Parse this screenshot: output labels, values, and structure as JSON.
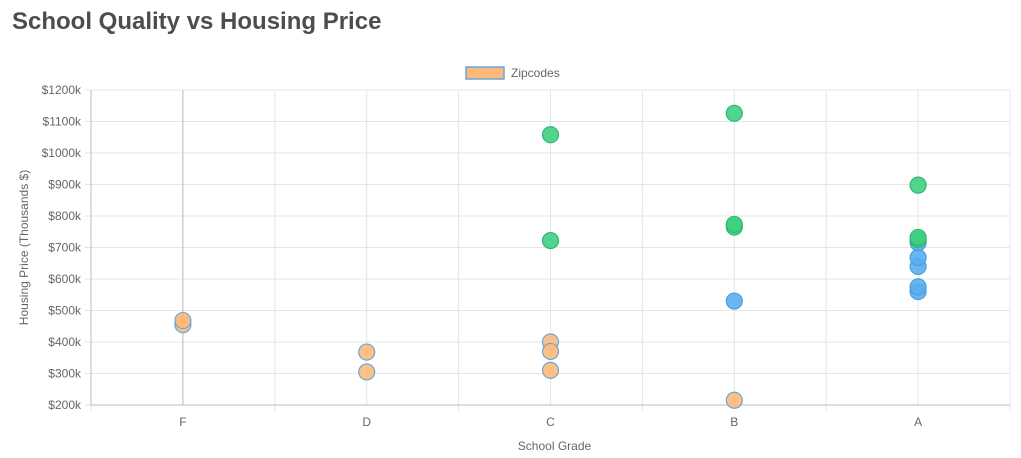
{
  "page": {
    "title": "School Quality vs Housing Price"
  },
  "colors": {
    "orange_fill": "#fdb97a",
    "orange_stroke": "#6aa6d8",
    "blue_fill": "#5aaef0",
    "blue_stroke": "#4a9ee0",
    "green_fill": "#3ecf82",
    "green_stroke": "#2fb870",
    "grid": "#e5e5e5",
    "axis_line": "#bbbbbb"
  },
  "chart_data": {
    "type": "scatter",
    "title": "School Quality vs Housing Price",
    "xlabel": "School Grade",
    "ylabel": "Housing Price (Thousands $)",
    "categories": [
      "F",
      "D",
      "C",
      "B",
      "A"
    ],
    "y_ticks": [
      "$200k",
      "$300k",
      "$400k",
      "$500k",
      "$600k",
      "$700k",
      "$800k",
      "$900k",
      "$1000k",
      "$1100k",
      "$1200k"
    ],
    "ylim": [
      200,
      1200
    ],
    "grid": true,
    "legend": {
      "position": "top-center",
      "entries": [
        {
          "label": "Zipcodes",
          "color": "#fdb97a"
        }
      ]
    },
    "series": [
      {
        "name": "Zipcodes",
        "points": [
          {
            "x": "F",
            "y": 455,
            "group": "orange"
          },
          {
            "x": "F",
            "y": 468,
            "group": "orange"
          },
          {
            "x": "D",
            "y": 368,
            "group": "orange"
          },
          {
            "x": "D",
            "y": 305,
            "group": "orange"
          },
          {
            "x": "C",
            "y": 400,
            "group": "orange"
          },
          {
            "x": "C",
            "y": 370,
            "group": "orange"
          },
          {
            "x": "C",
            "y": 310,
            "group": "orange"
          },
          {
            "x": "C",
            "y": 722,
            "group": "green"
          },
          {
            "x": "C",
            "y": 1058,
            "group": "green"
          },
          {
            "x": "B",
            "y": 215,
            "group": "orange"
          },
          {
            "x": "B",
            "y": 530,
            "group": "blue"
          },
          {
            "x": "B",
            "y": 765,
            "group": "green"
          },
          {
            "x": "B",
            "y": 773,
            "group": "green"
          },
          {
            "x": "B",
            "y": 1126,
            "group": "green"
          },
          {
            "x": "A",
            "y": 560,
            "group": "blue"
          },
          {
            "x": "A",
            "y": 575,
            "group": "blue"
          },
          {
            "x": "A",
            "y": 640,
            "group": "blue"
          },
          {
            "x": "A",
            "y": 668,
            "group": "blue"
          },
          {
            "x": "A",
            "y": 715,
            "group": "blue"
          },
          {
            "x": "A",
            "y": 725,
            "group": "green"
          },
          {
            "x": "A",
            "y": 732,
            "group": "green"
          },
          {
            "x": "A",
            "y": 898,
            "group": "green"
          }
        ]
      }
    ]
  }
}
